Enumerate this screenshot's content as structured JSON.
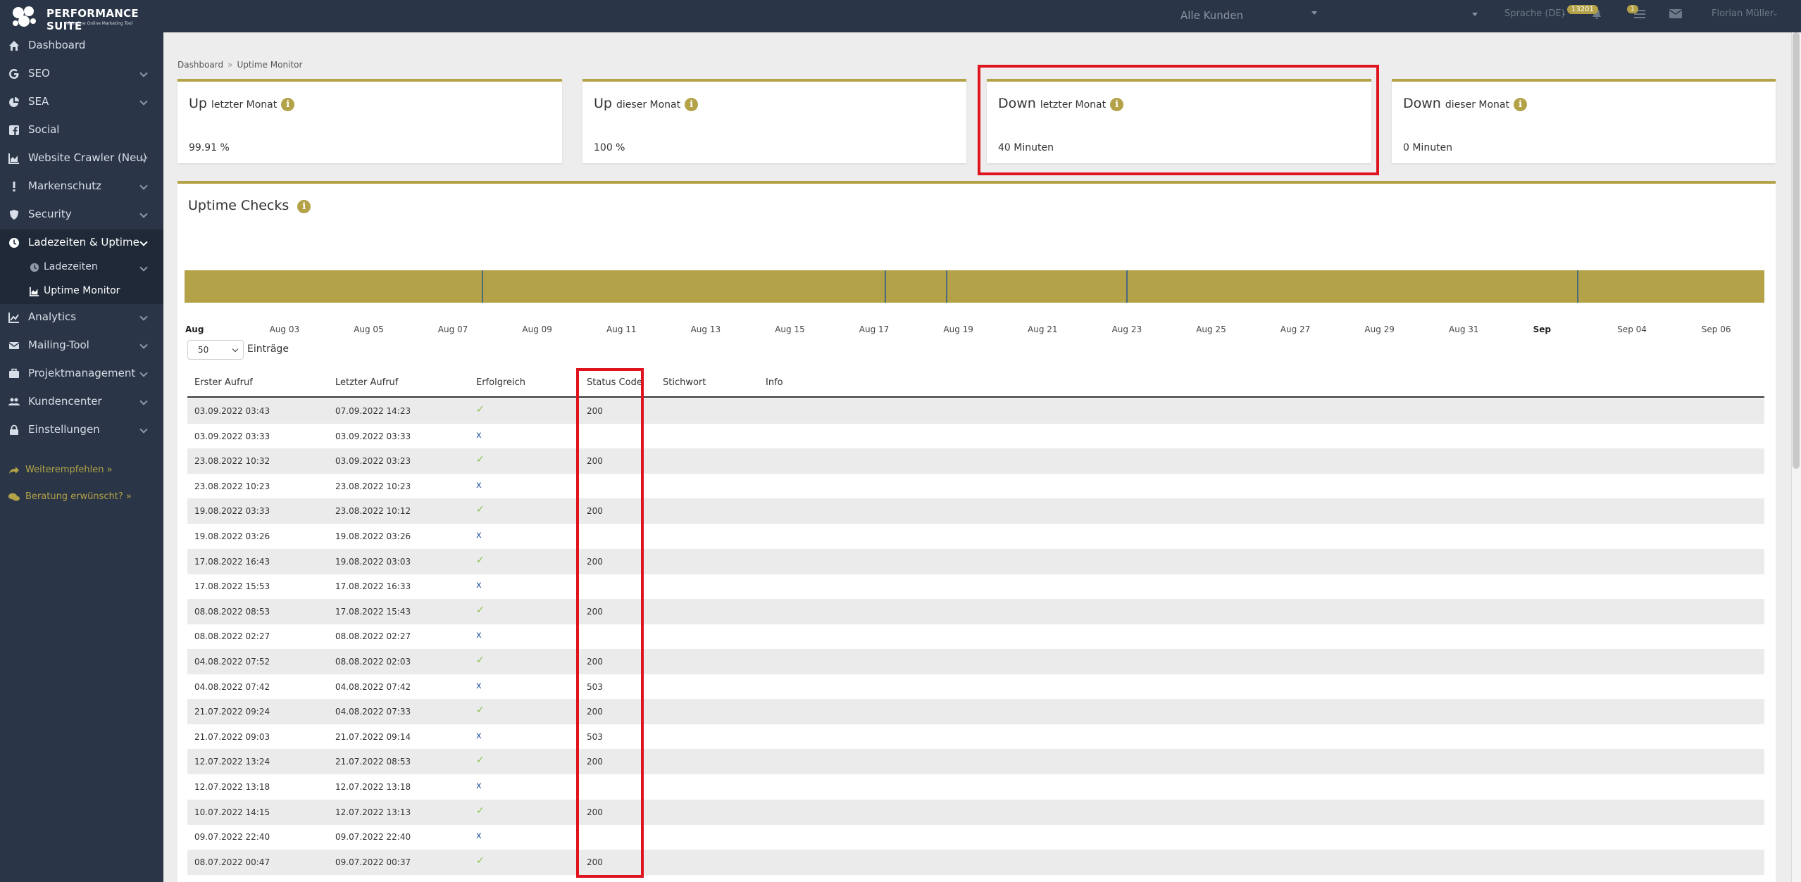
{
  "header": {
    "brand_title": "PERFORMANCE SUITE",
    "brand_subtitle": "All-in-One Online Marketing Tool",
    "customer_select": "Alle Kunden",
    "language": "Sprache (DE)",
    "notif_badge": "13201",
    "list_badge": "1",
    "user_name": "Florian Müller"
  },
  "sidebar": {
    "items": [
      {
        "label": "Dashboard",
        "icon": "home-icon"
      },
      {
        "label": "SEO",
        "icon": "google-icon"
      },
      {
        "label": "SEA",
        "icon": "pie-chart-icon"
      },
      {
        "label": "Social",
        "icon": "facebook-icon"
      },
      {
        "label": "Website Crawler (Neu)",
        "icon": "area-chart-icon"
      },
      {
        "label": "Markenschutz",
        "icon": "exclamation-icon"
      },
      {
        "label": "Security",
        "icon": "shield-icon"
      },
      {
        "label": "Ladezeiten & Uptime",
        "icon": "clock-icon"
      },
      {
        "label": "Analytics",
        "icon": "line-chart-icon"
      },
      {
        "label": "Mailing-Tool",
        "icon": "envelope-icon"
      },
      {
        "label": "Projektmanagement",
        "icon": "briefcase-icon"
      },
      {
        "label": "Kundencenter",
        "icon": "users-icon"
      },
      {
        "label": "Einstellungen",
        "icon": "lock-icon"
      }
    ],
    "sub_items": [
      {
        "label": "Ladezeiten",
        "icon": "clock-icon"
      },
      {
        "label": "Uptime Monitor",
        "icon": "area-chart-icon"
      }
    ],
    "recommend": "Weiterempfehlen »",
    "consult": "Beratung erwünscht? »"
  },
  "breadcrumb": {
    "home": "Dashboard",
    "separator": "»",
    "current": "Uptime Monitor"
  },
  "cards": [
    {
      "main": "Up",
      "sub": "letzter Monat",
      "value": "99.91 %"
    },
    {
      "main": "Up",
      "sub": "dieser Monat",
      "value": "100 %"
    },
    {
      "main": "Down",
      "sub": "letzter Monat",
      "value": "40 Minuten"
    },
    {
      "main": "Down",
      "sub": "dieser Monat",
      "value": "0 Minuten"
    }
  ],
  "uptime": {
    "title": "Uptime Checks",
    "timeline_dates": [
      "Aug",
      "Aug 03",
      "Aug 05",
      "Aug 07",
      "Aug 09",
      "Aug 11",
      "Aug 13",
      "Aug 15",
      "Aug 17",
      "Aug 19",
      "Aug 21",
      "Aug 23",
      "Aug 25",
      "Aug 27",
      "Aug 29",
      "Aug 31",
      "Sep",
      "Sep 04",
      "Sep 06"
    ],
    "page_length": "50",
    "page_length_label": "Einträge",
    "columns": [
      "Erster Aufruf",
      "Letzter Aufruf",
      "Erfolgreich",
      "Status Code",
      "Stichwort",
      "Info"
    ],
    "rows": [
      {
        "first": "03.09.2022 03:43",
        "last": "07.09.2022 14:23",
        "ok": "✓",
        "status": "200"
      },
      {
        "first": "03.09.2022 03:33",
        "last": "03.09.2022 03:33",
        "ok": "x",
        "status": ""
      },
      {
        "first": "23.08.2022 10:32",
        "last": "03.09.2022 03:23",
        "ok": "✓",
        "status": "200"
      },
      {
        "first": "23.08.2022 10:23",
        "last": "23.08.2022 10:23",
        "ok": "x",
        "status": ""
      },
      {
        "first": "19.08.2022 03:33",
        "last": "23.08.2022 10:12",
        "ok": "✓",
        "status": "200"
      },
      {
        "first": "19.08.2022 03:26",
        "last": "19.08.2022 03:26",
        "ok": "x",
        "status": ""
      },
      {
        "first": "17.08.2022 16:43",
        "last": "19.08.2022 03:03",
        "ok": "✓",
        "status": "200"
      },
      {
        "first": "17.08.2022 15:53",
        "last": "17.08.2022 16:33",
        "ok": "x",
        "status": ""
      },
      {
        "first": "08.08.2022 08:53",
        "last": "17.08.2022 15:43",
        "ok": "✓",
        "status": "200"
      },
      {
        "first": "08.08.2022 02:27",
        "last": "08.08.2022 02:27",
        "ok": "x",
        "status": ""
      },
      {
        "first": "04.08.2022 07:52",
        "last": "08.08.2022 02:03",
        "ok": "✓",
        "status": "200"
      },
      {
        "first": "04.08.2022 07:42",
        "last": "04.08.2022 07:42",
        "ok": "x",
        "status": "503"
      },
      {
        "first": "21.07.2022 09:24",
        "last": "04.08.2022 07:33",
        "ok": "✓",
        "status": "200"
      },
      {
        "first": "21.07.2022 09:03",
        "last": "21.07.2022 09:14",
        "ok": "x",
        "status": "503"
      },
      {
        "first": "12.07.2022 13:24",
        "last": "21.07.2022 08:53",
        "ok": "✓",
        "status": "200"
      },
      {
        "first": "12.07.2022 13:18",
        "last": "12.07.2022 13:18",
        "ok": "x",
        "status": ""
      },
      {
        "first": "10.07.2022 14:15",
        "last": "12.07.2022 13:13",
        "ok": "✓",
        "status": "200"
      },
      {
        "first": "09.07.2022 22:40",
        "last": "09.07.2022 22:40",
        "ok": "x",
        "status": ""
      },
      {
        "first": "08.07.2022 00:47",
        "last": "09.07.2022 00:37",
        "ok": "✓",
        "status": "200"
      }
    ]
  },
  "colors": {
    "sidebar_bg": "#2a3647",
    "accent_gold": "#b3a247",
    "highlight_red": "#e0141e",
    "success_green": "#8cbf4f",
    "fail_blue": "#2c5aa0"
  }
}
